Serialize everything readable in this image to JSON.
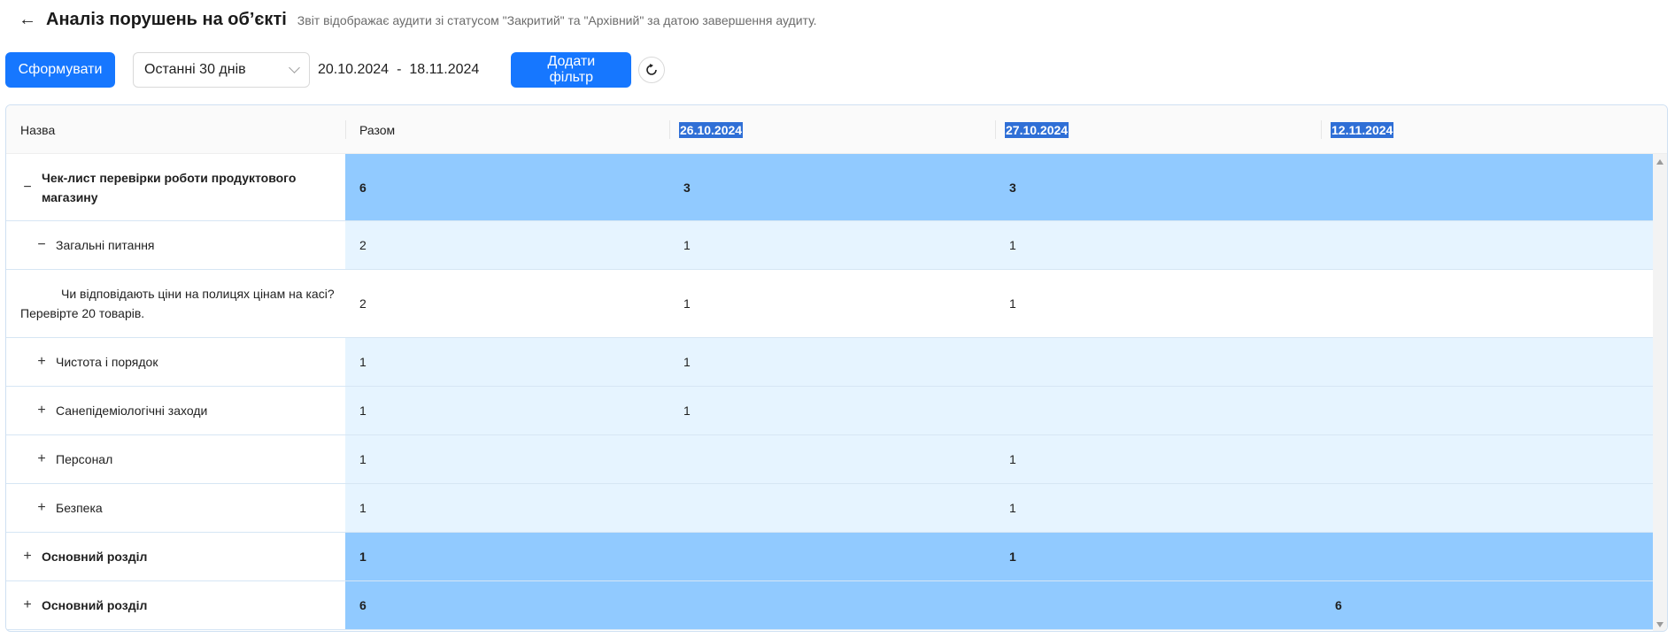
{
  "header": {
    "title": "Аналіз порушень на об’єкті",
    "subtitle": "Звіт відображає аудити зі статусом \"Закритий\" та \"Архівний\" за датою завершення аудиту."
  },
  "toolbar": {
    "generate_label": "Сформувати",
    "period_value": "Останні 30 днів",
    "date_from": "20.10.2024",
    "date_sep": "-",
    "date_to": "18.11.2024",
    "add_filter_label": "Додати фільтр"
  },
  "table": {
    "columns": {
      "name": "Назва",
      "total": "Разом",
      "dates": [
        "26.10.2024",
        "27.10.2024",
        "12.11.2024"
      ]
    },
    "rows": [
      {
        "level": 0,
        "toggle": "−",
        "name": "Чек-лист перевірки роботи продуктового магазину",
        "total": "6",
        "d1": "3",
        "d2": "3",
        "d3": ""
      },
      {
        "level": 1,
        "toggle": "−",
        "name": "Загальні питання",
        "total": "2",
        "d1": "1",
        "d2": "1",
        "d3": ""
      },
      {
        "level": 2,
        "toggle": "",
        "name": "Чи відповідають ціни на полицях цінам на касі? Перевірте 20 товарів.",
        "total": "2",
        "d1": "1",
        "d2": "1",
        "d3": ""
      },
      {
        "level": 1,
        "toggle": "+",
        "name": "Чистота і порядок",
        "total": "1",
        "d1": "1",
        "d2": "",
        "d3": ""
      },
      {
        "level": 1,
        "toggle": "+",
        "name": "Санепідеміологічні заходи",
        "total": "1",
        "d1": "1",
        "d2": "",
        "d3": ""
      },
      {
        "level": 1,
        "toggle": "+",
        "name": "Персонал",
        "total": "1",
        "d1": "",
        "d2": "1",
        "d3": ""
      },
      {
        "level": 1,
        "toggle": "+",
        "name": "Безпека",
        "total": "1",
        "d1": "",
        "d2": "1",
        "d3": ""
      },
      {
        "level": 0,
        "toggle": "+",
        "name": "Основний розділ",
        "total": "1",
        "d1": "",
        "d2": "1",
        "d3": ""
      },
      {
        "level": 0,
        "toggle": "+",
        "name": "Основний розділ",
        "total": "6",
        "d1": "",
        "d2": "",
        "d3": "6"
      }
    ]
  },
  "icons": {
    "back": "arrow-left-icon",
    "dropdown": "chevron-down-icon",
    "refresh": "refresh-icon"
  },
  "colors": {
    "primary": "#1677ff",
    "group_row": "#91caff",
    "subgroup_row": "#e6f4ff",
    "date_header_highlight": "#2f6fd6"
  }
}
